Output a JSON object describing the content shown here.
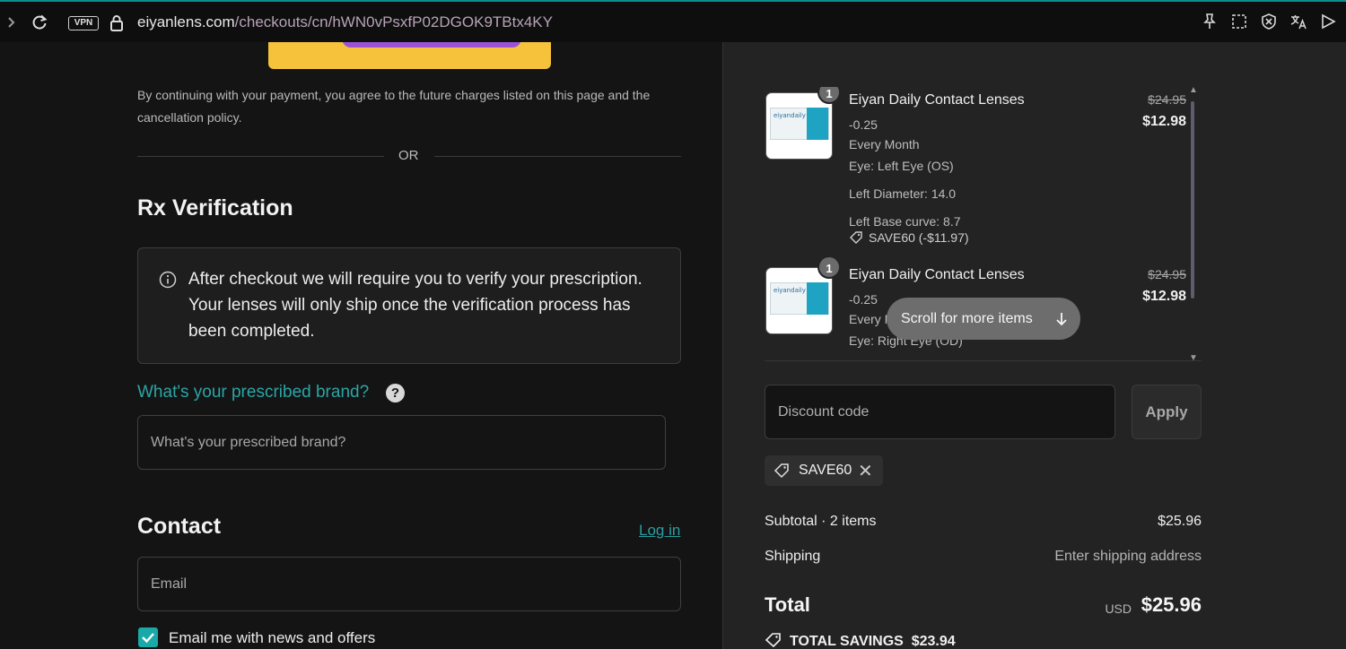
{
  "browser": {
    "vpn_label": "VPN",
    "url_host": "eiyanlens.com",
    "url_path": "/checkouts/cn/hWN0vPsxfP02DGOK9TBtx4KY",
    "icons": [
      "forward-icon",
      "reload-icon",
      "lock-icon",
      "pin-icon",
      "screenshot-icon",
      "shield-icon",
      "translate-icon",
      "send-icon"
    ]
  },
  "payment": {
    "consent_text": "By continuing with your payment, you agree to the future charges listed on this page and the cancellation policy.",
    "or_label": "OR"
  },
  "rx": {
    "title": "Rx Verification",
    "info_text": "After checkout we will require you to verify your prescription. Your lenses will only ship once the verification process has been completed.",
    "brand_label": "What's your prescribed brand?",
    "brand_placeholder": "What's your prescribed brand?",
    "help_glyph": "?"
  },
  "contact": {
    "title": "Contact",
    "login_label": "Log in",
    "email_placeholder": "Email",
    "newsletter_label": "Email me with news and offers",
    "newsletter_checked": true
  },
  "cart": {
    "items": [
      {
        "qty": "1",
        "title": "Eiyan Daily Contact Lenses",
        "power": "-0.25",
        "frequency": "Every Month",
        "eye": "Eye: Left Eye (OS)",
        "diameter": "Left Diameter: 14.0",
        "base_curve": "Left Base curve: 8.7",
        "discount": "SAVE60 (-$11.97)",
        "original_price": "$24.95",
        "price": "$12.98"
      },
      {
        "qty": "1",
        "title": "Eiyan Daily Contact Lenses",
        "power": "-0.25",
        "frequency": "Every Month",
        "eye": "Eye: Right Eye (OD)",
        "original_price": "$24.95",
        "price": "$12.98"
      }
    ],
    "scroll_hint": "Scroll for more items",
    "product_logo_text": "eiyandaily"
  },
  "discount": {
    "placeholder": "Discount code",
    "apply_label": "Apply",
    "applied_code": "SAVE60",
    "remove_glyph": "✕"
  },
  "summary": {
    "subtotal_label": "Subtotal · 2 items",
    "subtotal_value": "$25.96",
    "shipping_label": "Shipping",
    "shipping_value": "Enter shipping address",
    "total_label": "Total",
    "currency": "USD",
    "total_value": "$25.96",
    "savings_label": "TOTAL SAVINGS",
    "savings_value": "$23.94"
  },
  "colors": {
    "accent_teal": "#1aa9a9",
    "link_teal": "#2a9ea4",
    "paypal_yellow": "#f7c23b",
    "panel_dark": "#141414",
    "panel_summary": "#232323"
  }
}
